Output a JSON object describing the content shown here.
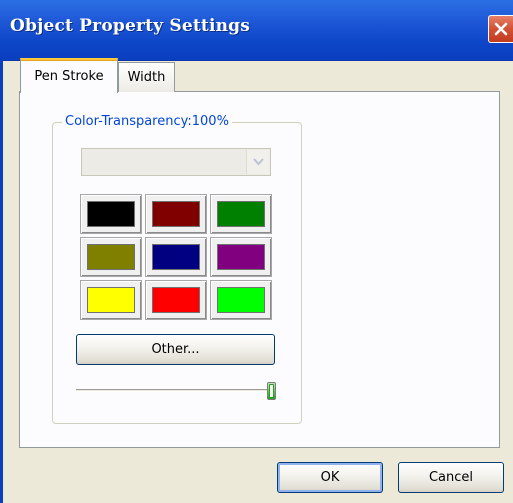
{
  "window": {
    "title": "Object Property Settings"
  },
  "tabs": [
    {
      "label": "Pen Stroke",
      "active": true
    },
    {
      "label": "Width",
      "active": false
    }
  ],
  "group": {
    "label": "Color-Transparency:100%"
  },
  "color_dropdown": {
    "value": ""
  },
  "swatches": [
    {
      "name": "black",
      "color": "#000000"
    },
    {
      "name": "maroon",
      "color": "#800000"
    },
    {
      "name": "green",
      "color": "#008000"
    },
    {
      "name": "olive",
      "color": "#808000"
    },
    {
      "name": "navy",
      "color": "#000080"
    },
    {
      "name": "purple",
      "color": "#800080"
    },
    {
      "name": "yellow",
      "color": "#ffff00"
    },
    {
      "name": "red",
      "color": "#ff0000"
    },
    {
      "name": "lime",
      "color": "#00ff00"
    }
  ],
  "other_button": {
    "label": "Other..."
  },
  "transparency_slider": {
    "value_percent": 100
  },
  "footer": {
    "ok_label": "OK",
    "cancel_label": "Cancel"
  },
  "colors": {
    "titlebar": "#0a3fbf",
    "dialog_bg": "#ece9d8",
    "panel_bg": "#fcfcfe",
    "active_tab_accent": "#ffc83c",
    "legend_text": "#0046d5"
  }
}
